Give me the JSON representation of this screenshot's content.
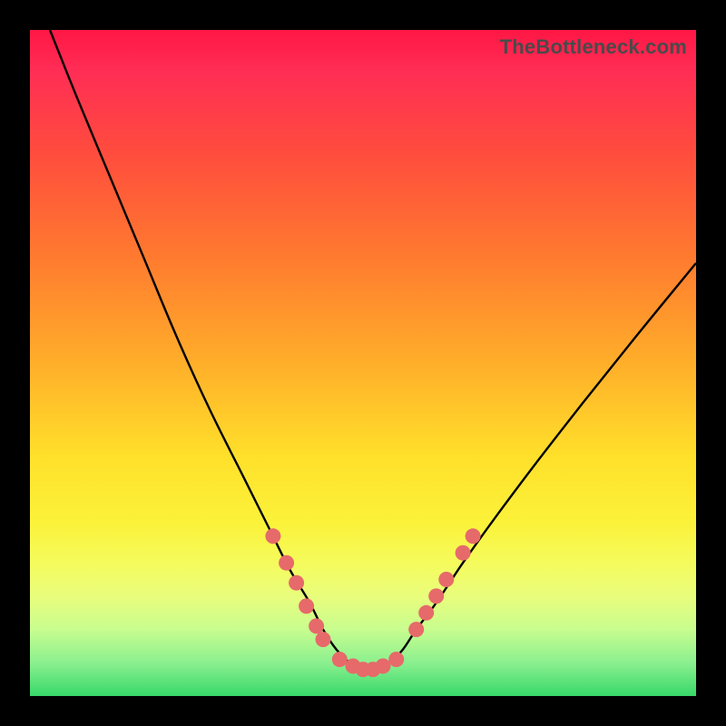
{
  "watermark": "TheBottleneck.com",
  "colors": {
    "frame": "#000000",
    "curve_stroke": "#000000",
    "marker_fill": "#e66a6a",
    "marker_stroke": "#c74f4f"
  },
  "chart_data": {
    "type": "line",
    "title": "",
    "xlabel": "",
    "ylabel": "",
    "xlim": [
      0,
      100
    ],
    "ylim": [
      0,
      100
    ],
    "grid": false,
    "legend": false,
    "series": [
      {
        "name": "bottleneck-curve",
        "x": [
          3,
          7,
          12,
          17,
          22,
          27,
          32,
          36,
          39,
          42,
          44,
          46,
          48,
          50,
          52,
          54,
          56,
          58,
          61,
          65,
          70,
          76,
          83,
          91,
          100
        ],
        "y": [
          100,
          90,
          78,
          66,
          54,
          43,
          33,
          25,
          19,
          14,
          10,
          7,
          5,
          4,
          4,
          5,
          7,
          10,
          14,
          20,
          27,
          35,
          44,
          54,
          65
        ]
      }
    ],
    "markers": [
      {
        "x": 36.5,
        "y": 24
      },
      {
        "x": 38.5,
        "y": 20
      },
      {
        "x": 40.0,
        "y": 17
      },
      {
        "x": 41.5,
        "y": 13.5
      },
      {
        "x": 43.0,
        "y": 10.5
      },
      {
        "x": 44.0,
        "y": 8.5
      },
      {
        "x": 46.5,
        "y": 5.5
      },
      {
        "x": 48.5,
        "y": 4.5
      },
      {
        "x": 50.0,
        "y": 4.0
      },
      {
        "x": 51.5,
        "y": 4.0
      },
      {
        "x": 53.0,
        "y": 4.5
      },
      {
        "x": 55.0,
        "y": 5.5
      },
      {
        "x": 58.0,
        "y": 10.0
      },
      {
        "x": 59.5,
        "y": 12.5
      },
      {
        "x": 61.0,
        "y": 15.0
      },
      {
        "x": 62.5,
        "y": 17.5
      },
      {
        "x": 65.0,
        "y": 21.5
      },
      {
        "x": 66.5,
        "y": 24.0
      }
    ]
  }
}
